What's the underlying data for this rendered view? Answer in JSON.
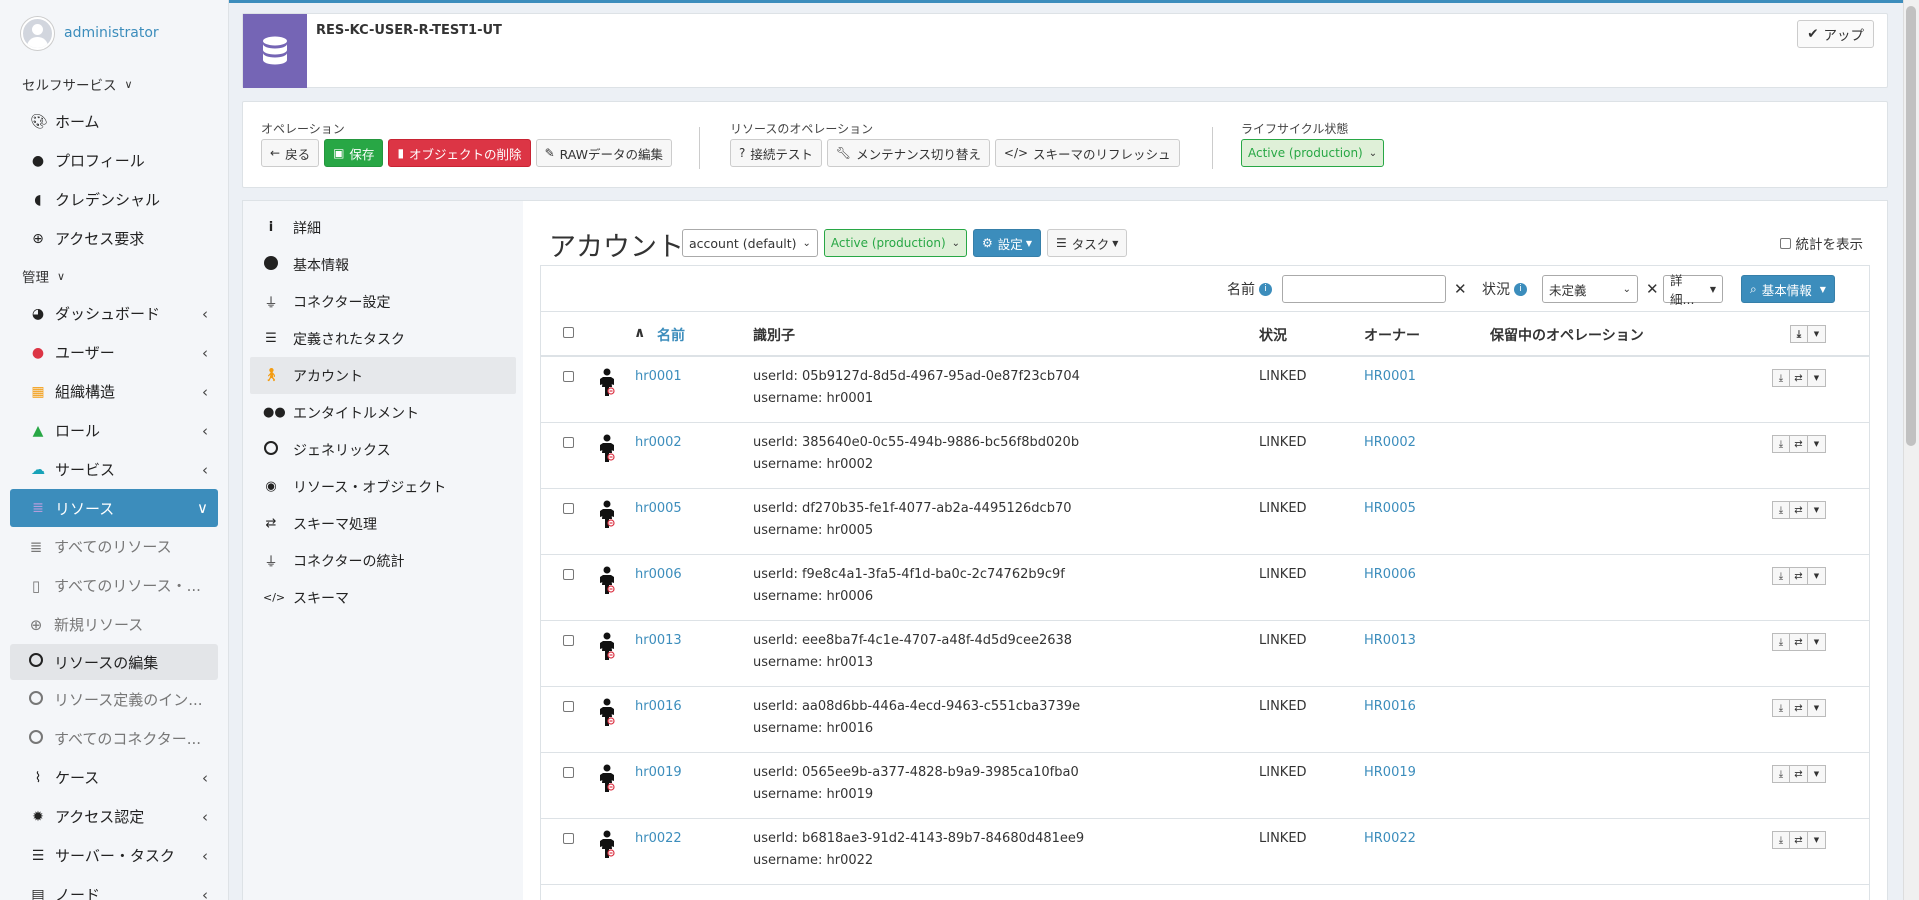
{
  "sidebar": {
    "user_name": "administrator",
    "section_selfservice": "セルフサービス",
    "selfservice_items": [
      {
        "label": "ホーム",
        "icon": "palette-icon"
      },
      {
        "label": "プロフィール",
        "icon": "user-icon"
      },
      {
        "label": "クレデンシャル",
        "icon": "shield-icon"
      },
      {
        "label": "アクセス要求",
        "icon": "plus-circle-icon"
      }
    ],
    "section_admin": "管理",
    "admin_items": [
      {
        "label": "ダッシュボード"
      },
      {
        "label": "ユーザー"
      },
      {
        "label": "組織構造"
      },
      {
        "label": "ロール"
      },
      {
        "label": "サービス"
      },
      {
        "label": "リソース"
      }
    ],
    "resource_sub": [
      {
        "label": "すべてのリソース"
      },
      {
        "label": "すべてのリソース・..."
      },
      {
        "label": "新規リソース"
      },
      {
        "label": "リソースの編集"
      },
      {
        "label": "リソース定義のイン..."
      },
      {
        "label": "すべてのコネクター..."
      }
    ],
    "bottom_items": [
      {
        "label": "ケース"
      },
      {
        "label": "アクセス認定"
      },
      {
        "label": "サーバー・タスク"
      },
      {
        "label": "ノード"
      }
    ]
  },
  "header": {
    "resource_name": "RES-KC-USER-R-TEST1-UT",
    "up_button": "アップ"
  },
  "operations": {
    "label": "オペレーション",
    "back": "戻る",
    "save": "保存",
    "delete": "オブジェクトの削除",
    "raw_edit": "RAWデータの編集",
    "resource_ops_label": "リソースのオペレーション",
    "test_connection": "接続テスト",
    "maintenance": "メンテナンス切り替え",
    "schema_refresh": "スキーマのリフレッシュ",
    "lifecycle_label": "ライフサイクル状態",
    "lifecycle_value": "Active (production)"
  },
  "left_menu": [
    {
      "label": "詳細"
    },
    {
      "label": "基本情報"
    },
    {
      "label": "コネクター設定"
    },
    {
      "label": "定義されたタスク"
    },
    {
      "label": "アカウント"
    },
    {
      "label": "エンタイトルメント"
    },
    {
      "label": "ジェネリックス"
    },
    {
      "label": "リソース・オブジェクト"
    },
    {
      "label": "スキーマ処理"
    },
    {
      "label": "コネクターの統計"
    },
    {
      "label": "スキーマ"
    }
  ],
  "accounts": {
    "title": "アカウント",
    "kind_select": "account (default)",
    "lifecycle_select": "Active (production)",
    "settings_button": "設定",
    "tasks_button": "タスク",
    "show_stats": "統計を表示",
    "filter": {
      "name_label": "名前",
      "name_value": "",
      "status_label": "状況",
      "status_value": "未定義",
      "more": "詳細...",
      "basic_search": "基本情報"
    },
    "columns": {
      "name": "名前",
      "identifiers": "識別子",
      "status": "状況",
      "owner": "オーナー",
      "pending": "保留中のオペレーション"
    },
    "rows": [
      {
        "name": "hr0001",
        "id1": "userId: 05b9127d-8d5d-4967-95ad-0e87f23cb704",
        "id2": "username: hr0001",
        "status": "LINKED",
        "owner": "HR0001"
      },
      {
        "name": "hr0002",
        "id1": "userId: 385640e0-0c55-494b-9886-bc56f8bd020b",
        "id2": "username: hr0002",
        "status": "LINKED",
        "owner": "HR0002"
      },
      {
        "name": "hr0005",
        "id1": "userId: df270b35-fe1f-4077-ab2a-4495126dcb70",
        "id2": "username: hr0005",
        "status": "LINKED",
        "owner": "HR0005"
      },
      {
        "name": "hr0006",
        "id1": "userId: f9e8c4a1-3fa5-4f1d-ba0c-2c74762b9c9f",
        "id2": "username: hr0006",
        "status": "LINKED",
        "owner": "HR0006"
      },
      {
        "name": "hr0013",
        "id1": "userId: eee8ba7f-4c1e-4707-a48f-4d5d9cee2638",
        "id2": "username: hr0013",
        "status": "LINKED",
        "owner": "HR0013"
      },
      {
        "name": "hr0016",
        "id1": "userId: aa08d6bb-446a-4ecd-9463-c551cba3739e",
        "id2": "username: hr0016",
        "status": "LINKED",
        "owner": "HR0016"
      },
      {
        "name": "hr0019",
        "id1": "userId: 0565ee9b-a377-4828-b9a9-3985ca10fba0",
        "id2": "username: hr0019",
        "status": "LINKED",
        "owner": "HR0019"
      },
      {
        "name": "hr0022",
        "id1": "userId: b6818ae3-91d2-4143-89b7-84680d481ee9",
        "id2": "username: hr0022",
        "status": "LINKED",
        "owner": "HR0022"
      }
    ]
  },
  "colors": {
    "accent": "#3c8dbc",
    "save": "#28a745",
    "delete": "#dc3545",
    "resource_icon_bg": "#7565b5"
  }
}
